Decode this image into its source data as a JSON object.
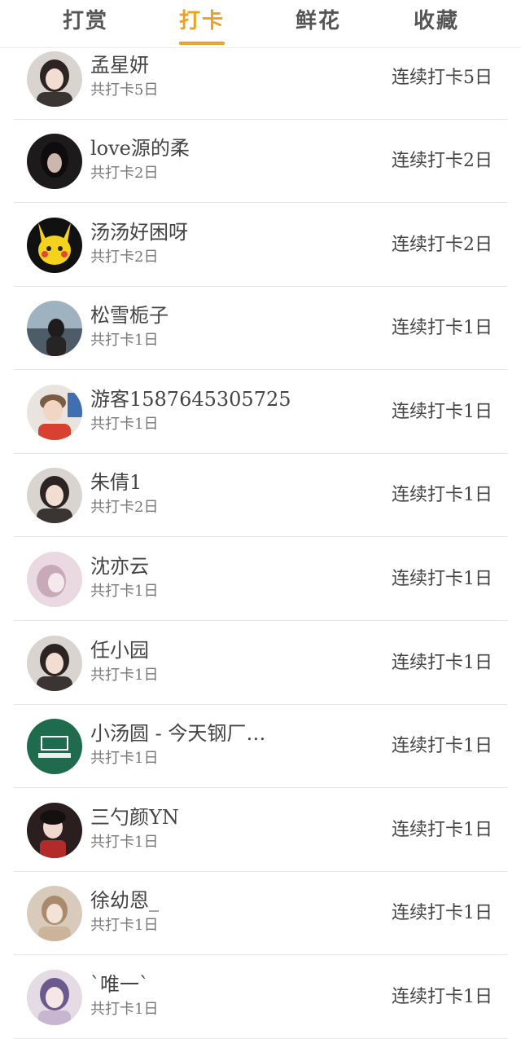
{
  "tabs": [
    {
      "label": "打赏",
      "active": false
    },
    {
      "label": "打卡",
      "active": true
    },
    {
      "label": "鲜花",
      "active": false
    },
    {
      "label": "收藏",
      "active": false
    }
  ],
  "colors": {
    "accent": "#f0a020",
    "divider": "#e6e6e6",
    "text": "#444444",
    "subtext": "#777777"
  },
  "rows": [
    {
      "name": "孟星妍",
      "total": "共打卡5日",
      "streak": "连续打卡5日",
      "avatar": "avatar-photo-girl"
    },
    {
      "name": "love源的柔",
      "total": "共打卡2日",
      "streak": "连续打卡2日",
      "avatar": "avatar-photo-dark"
    },
    {
      "name": "汤汤好困呀",
      "total": "共打卡2日",
      "streak": "连续打卡2日",
      "avatar": "avatar-pikachu"
    },
    {
      "name": "松雪栀子",
      "total": "共打卡1日",
      "streak": "连续打卡1日",
      "avatar": "avatar-photo-sea"
    },
    {
      "name": "游客1587645305725",
      "total": "共打卡1日",
      "streak": "连续打卡1日",
      "avatar": "avatar-photo-boy"
    },
    {
      "name": "朱倩1",
      "total": "共打卡2日",
      "streak": "连续打卡1日",
      "avatar": "avatar-photo-girl"
    },
    {
      "name": "沈亦云",
      "total": "共打卡1日",
      "streak": "连续打卡1日",
      "avatar": "avatar-illustration"
    },
    {
      "name": "任小园",
      "total": "共打卡1日",
      "streak": "连续打卡1日",
      "avatar": "avatar-photo-girl"
    },
    {
      "name": "小汤圆 - 今天钢厂…",
      "total": "共打卡1日",
      "streak": "连续打卡1日",
      "avatar": "avatar-green-logo"
    },
    {
      "name": "三勺颜YN",
      "total": "共打卡1日",
      "streak": "连续打卡1日",
      "avatar": "avatar-photo-red"
    },
    {
      "name": "徐幼恩_",
      "total": "共打卡1日",
      "streak": "连续打卡1日",
      "avatar": "avatar-photo-light"
    },
    {
      "name": "`唯一`",
      "total": "共打卡1日",
      "streak": "连续打卡1日",
      "avatar": "avatar-photo-purple"
    }
  ]
}
